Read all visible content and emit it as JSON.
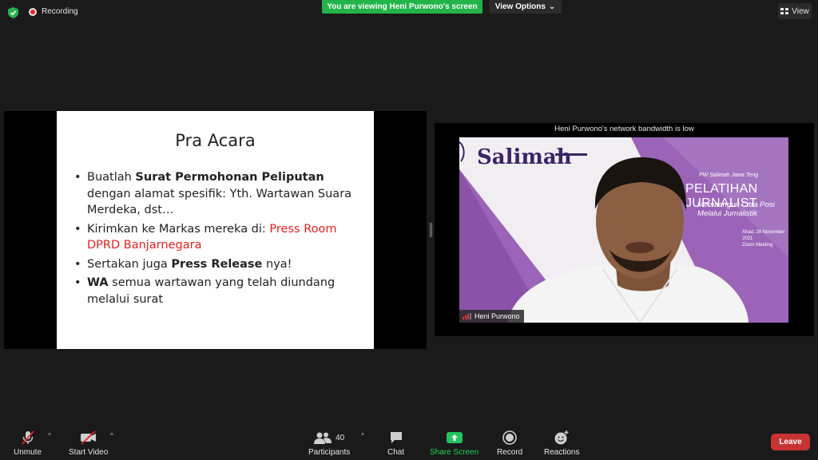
{
  "topbar": {
    "recording_label": "Recording",
    "viewing_text": "You are viewing Heni Purwono's screen",
    "view_options_label": "View Options",
    "view_label": "View"
  },
  "slide": {
    "title": "Pra Acara",
    "bullets": [
      {
        "pre": "Buatlah ",
        "bold": "Surat Permohonan Peliputan",
        "post": " dengan alamat spesifik: Yth. Wartawan Suara Merdeka, dst…"
      },
      {
        "pre": "Kirimkan ke Markas mereka di: ",
        "red": "Press Room DPRD Banjarnegara"
      },
      {
        "pre": "Sertakan juga ",
        "bold": "Press Release",
        "post": " nya!"
      },
      {
        "bold": "WA",
        "post": " semua wartawan yang telah diundang melalui surat"
      }
    ]
  },
  "video": {
    "bandwidth_notice": "Heni Purwono's network bandwidth is low",
    "participant_name": "Heni Purwono",
    "banner": {
      "brand": "Salimah",
      "org": "PW Salimah Jawa Teng",
      "headline": "PELATIHAN JURNALIST",
      "subhead_1": "Membangun Citra Posi",
      "subhead_2": "Melalui Jurnalistik",
      "date": "Ahad, 28 November 2021",
      "venue": "Zoom Meeting"
    }
  },
  "toolbar": {
    "unmute": "Unmute",
    "start_video": "Start Video",
    "participants": "Participants",
    "participant_count": "40",
    "chat": "Chat",
    "share_screen": "Share Screen",
    "record": "Record",
    "reactions": "Reactions",
    "leave": "Leave"
  },
  "colors": {
    "share_green": "#22b34a",
    "leave_red": "#c73333",
    "banner_purple": "#9b64b8",
    "highlight_red": "#e02020"
  }
}
